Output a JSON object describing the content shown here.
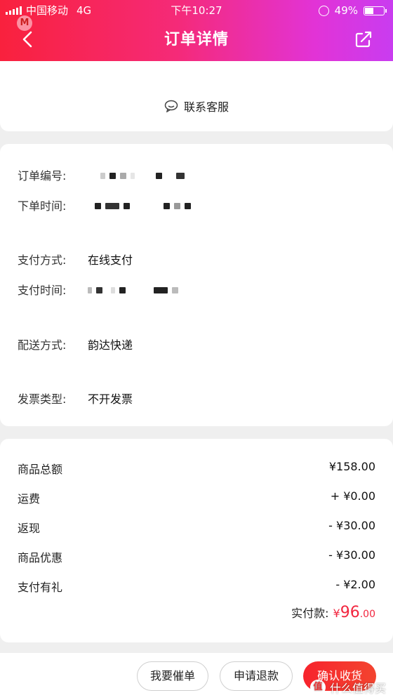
{
  "status_bar": {
    "carrier": "中国移动",
    "network": "4G",
    "time": "下午10:27",
    "battery": "49%",
    "battery_level": 0.49
  },
  "header": {
    "title": "订单详情",
    "back_icon": "chevron-left-icon",
    "share_icon": "share-icon"
  },
  "service": {
    "label": "联系客服",
    "icon": "chat-icon"
  },
  "order_info": {
    "order_no_label": "订单编号:",
    "order_time_label": "下单时间:",
    "payment_method_label": "支付方式:",
    "payment_method_value": "在线支付",
    "payment_time_label": "支付时间:",
    "delivery_label": "配送方式:",
    "delivery_value": "韵达快递",
    "invoice_label": "发票类型:",
    "invoice_value": "不开发票"
  },
  "price": {
    "rows": [
      {
        "label": "商品总额",
        "value": "¥158.00"
      },
      {
        "label": "运费",
        "value": "+ ¥0.00"
      },
      {
        "label": "返现",
        "value": "- ¥30.00"
      },
      {
        "label": "商品优惠",
        "value": "- ¥30.00"
      },
      {
        "label": "支付有礼",
        "value": "- ¥2.00"
      }
    ],
    "total_label": "实付款:",
    "total_currency": "¥",
    "total_int": "96",
    "total_dec": ".00",
    "accent_color": "#f2263f"
  },
  "actions": {
    "urge_label": "我要催单",
    "refund_label": "申请退款",
    "confirm_label": "确认收货"
  },
  "watermark": {
    "text": "什么值得买",
    "badge": "值"
  }
}
